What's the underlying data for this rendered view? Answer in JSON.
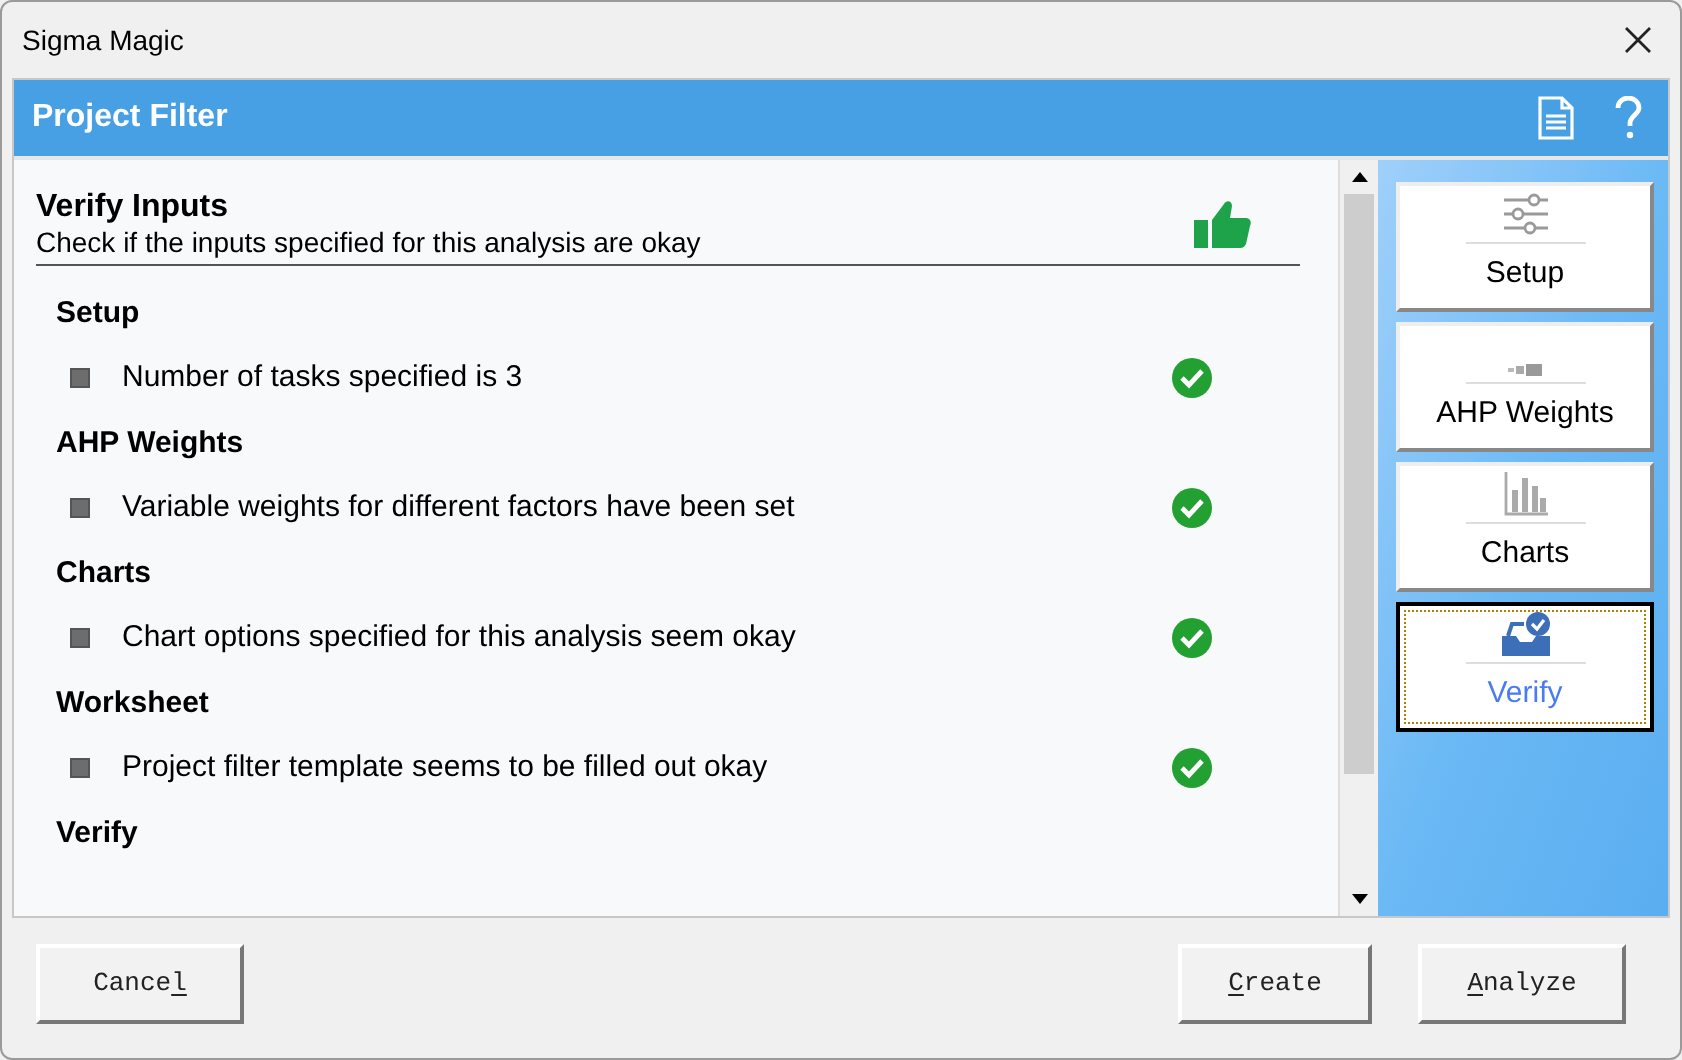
{
  "window": {
    "title": "Sigma Magic"
  },
  "header": {
    "title": "Project Filter"
  },
  "verify": {
    "title": "Verify Inputs",
    "subtitle": "Check if the inputs specified for this analysis are okay",
    "sections": [
      {
        "title": "Setup",
        "items": [
          {
            "text": "Number of tasks specified is 3",
            "ok": true
          }
        ]
      },
      {
        "title": "AHP Weights",
        "items": [
          {
            "text": "Variable weights for different factors have been set",
            "ok": true
          }
        ]
      },
      {
        "title": "Charts",
        "items": [
          {
            "text": "Chart options specified for this analysis seem okay",
            "ok": true
          }
        ]
      },
      {
        "title": "Worksheet",
        "items": [
          {
            "text": "Project filter template seems to be filled out okay",
            "ok": true
          }
        ]
      },
      {
        "title": "Verify"
      }
    ]
  },
  "nav": [
    {
      "label": "Setup",
      "kind": "sliders",
      "selected": false
    },
    {
      "label": "AHP Weights",
      "kind": "weights",
      "selected": false
    },
    {
      "label": "Charts",
      "kind": "chart",
      "selected": false
    },
    {
      "label": "Verify",
      "kind": "inbox",
      "selected": true
    }
  ],
  "buttons": [
    {
      "kind": "cancel",
      "parts": [
        {
          "text": "Cance",
          "underlined": false
        },
        {
          "text": "l",
          "underlined": true
        }
      ]
    },
    {
      "kind": "create",
      "parts": [
        {
          "text": "C",
          "underlined": true
        },
        {
          "text": "reate",
          "underlined": false
        }
      ]
    },
    {
      "kind": "analyze",
      "parts": [
        {
          "text": "A",
          "underlined": true
        },
        {
          "text": "nalyze",
          "underlined": false
        }
      ]
    }
  ]
}
